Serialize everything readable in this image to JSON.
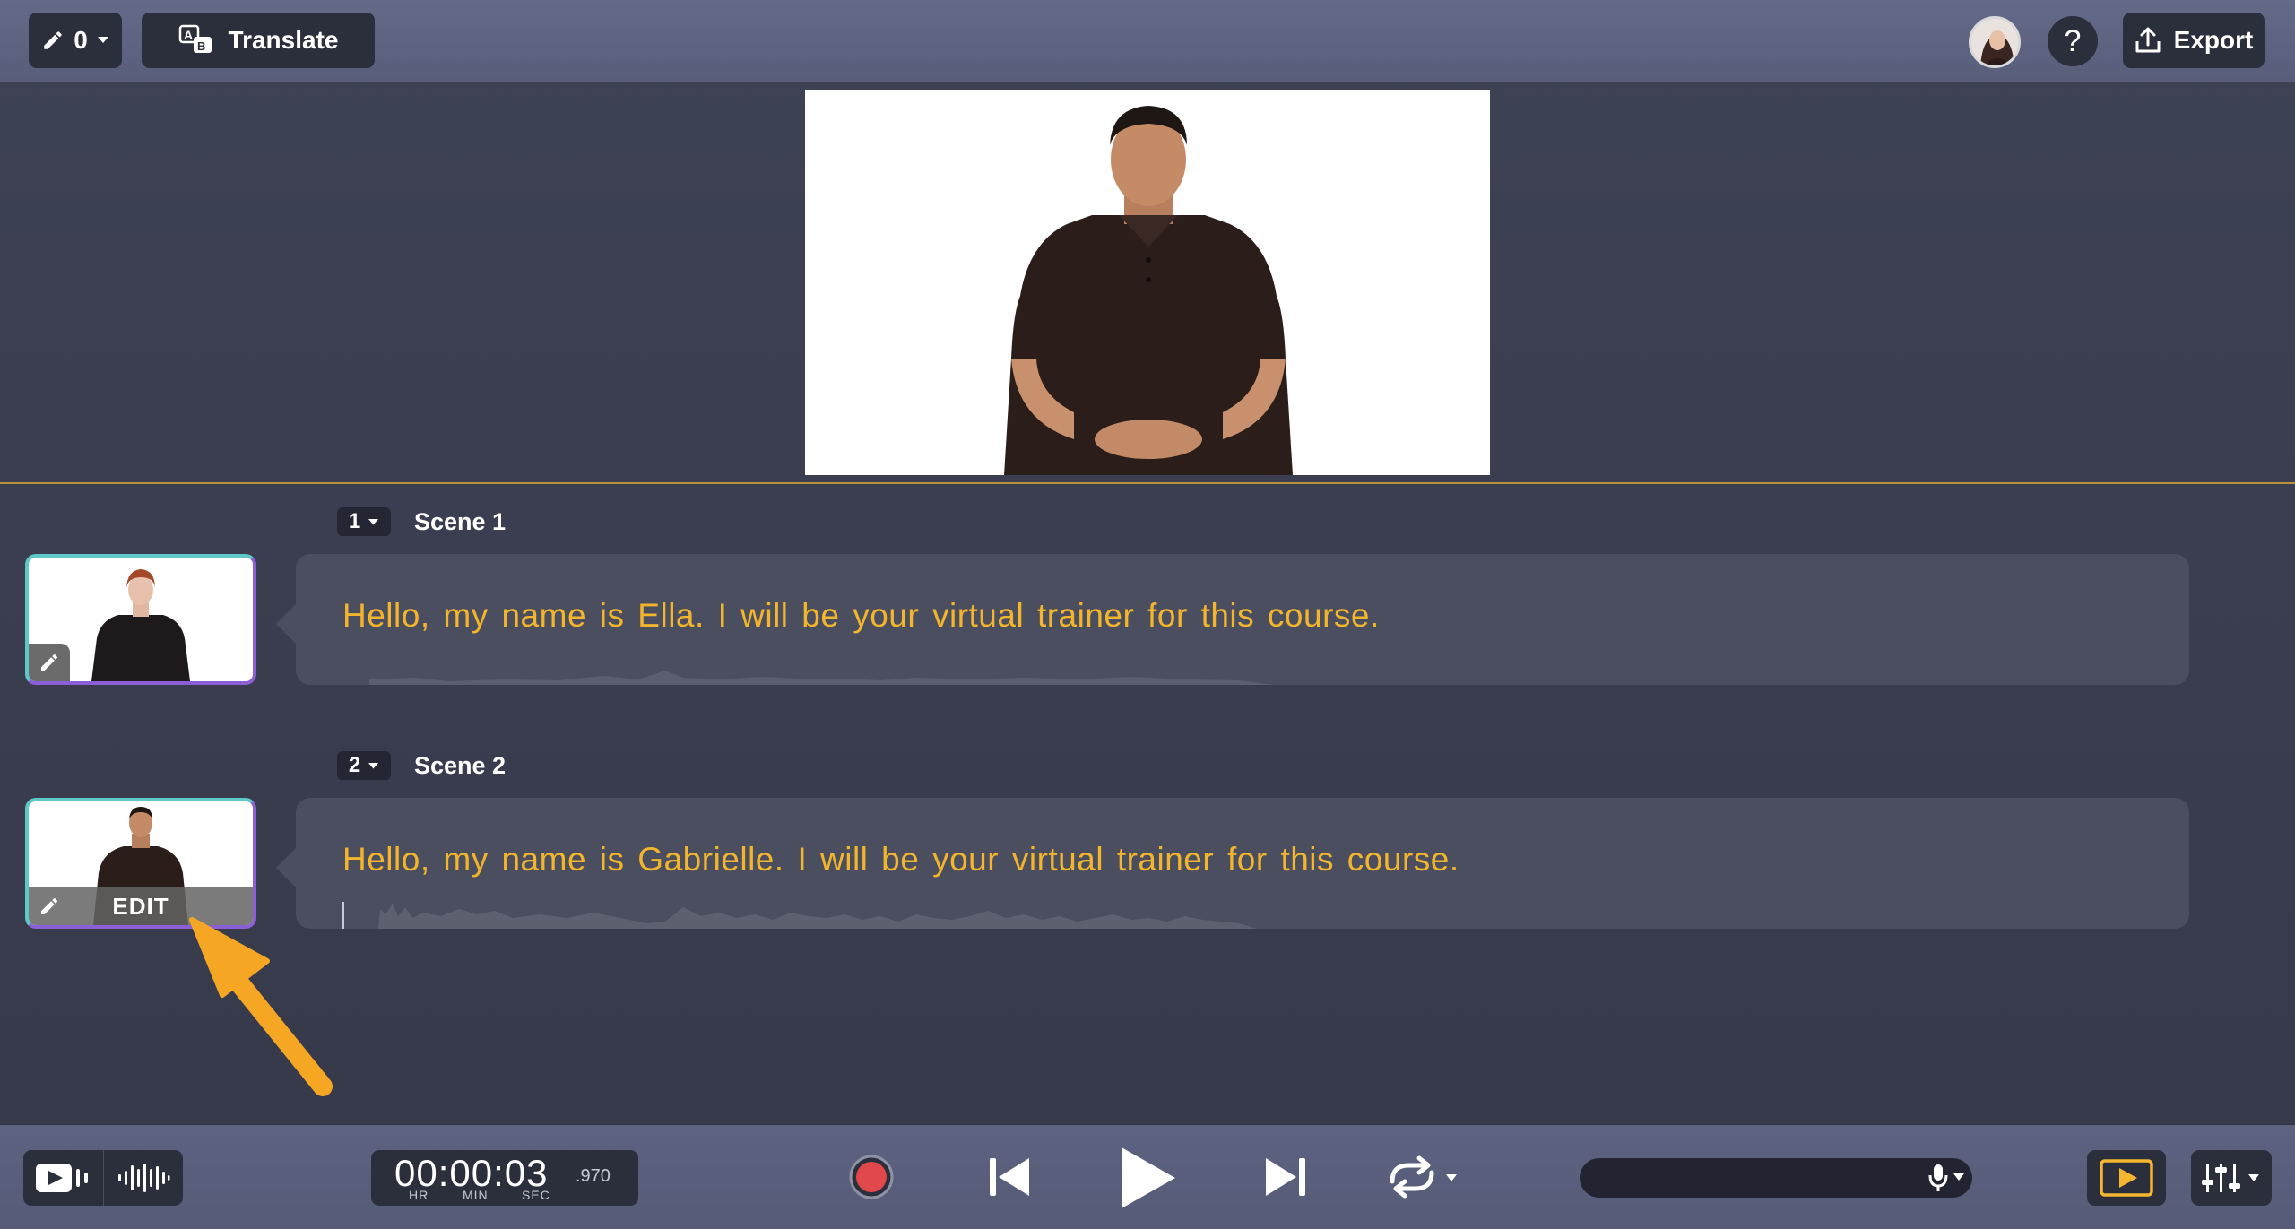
{
  "toolbar": {
    "edit_count": "0",
    "translate_label": "Translate",
    "export_label": "Export",
    "help_label": "?"
  },
  "scenes": [
    {
      "number": "1",
      "title": "Scene 1",
      "script": "Hello, my name is Ella. I will be your virtual trainer for this course."
    },
    {
      "number": "2",
      "title": "Scene 2",
      "script": "Hello, my name is Gabrielle. I will be your virtual trainer for this course.",
      "thumb_overlay": "EDIT"
    }
  ],
  "transport": {
    "timecode": "00:00:03",
    "milliseconds": ".970",
    "unit_hr": "HR",
    "unit_min": "MIN",
    "unit_sec": "SEC"
  },
  "colors": {
    "accent_text": "#f2b52c",
    "record": "#e0484b",
    "thumb_border_start": "#5ec8c8",
    "thumb_border_end": "#8b5fd6",
    "divider": "#b8933a"
  },
  "icons": {
    "edit": "pencil-icon",
    "translate": "translate-icon",
    "export": "upload-icon",
    "help": "question-icon",
    "record": "record-icon",
    "skip_back": "skip-back-icon",
    "play": "play-icon",
    "skip_forward": "skip-forward-icon",
    "loop": "loop-icon",
    "mic": "microphone-icon",
    "settings": "sliders-icon"
  }
}
